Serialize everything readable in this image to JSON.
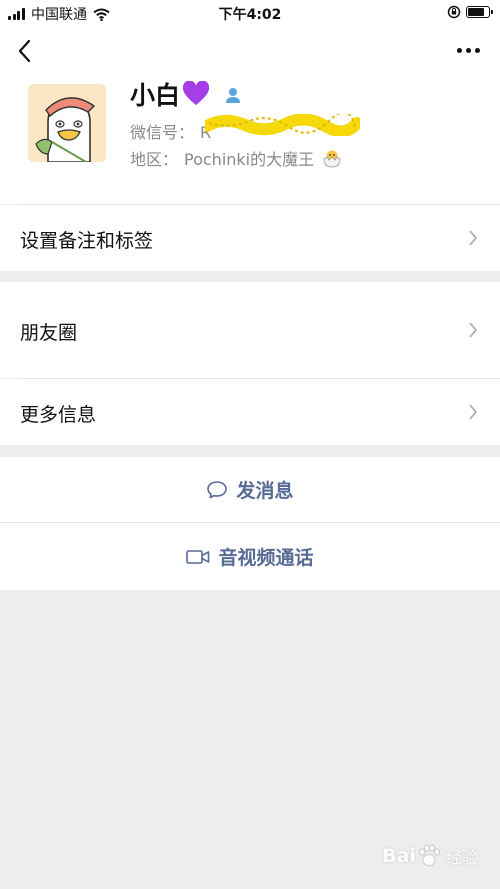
{
  "status_bar": {
    "carrier": "中国联通",
    "time": "下午4:02"
  },
  "profile": {
    "nickname": "小白",
    "wechat_id_label": "微信号：",
    "wechat_id_value": "R",
    "region_label": "地区：",
    "region_value": "Pochinki的大魔王",
    "avatar_icon": "duck-avatar",
    "gender_icon": "person-icon"
  },
  "menu": {
    "remark_tags": "设置备注和标签",
    "moments": "朋友圈",
    "more_info": "更多信息"
  },
  "actions": {
    "send_message": "发消息",
    "video_call": "音视频通话"
  },
  "watermark": {
    "brand": "Bai",
    "sub": "经验"
  },
  "colors": {
    "link_blue": "#576b95",
    "background": "#ededed",
    "heart": "#a33ee8"
  }
}
